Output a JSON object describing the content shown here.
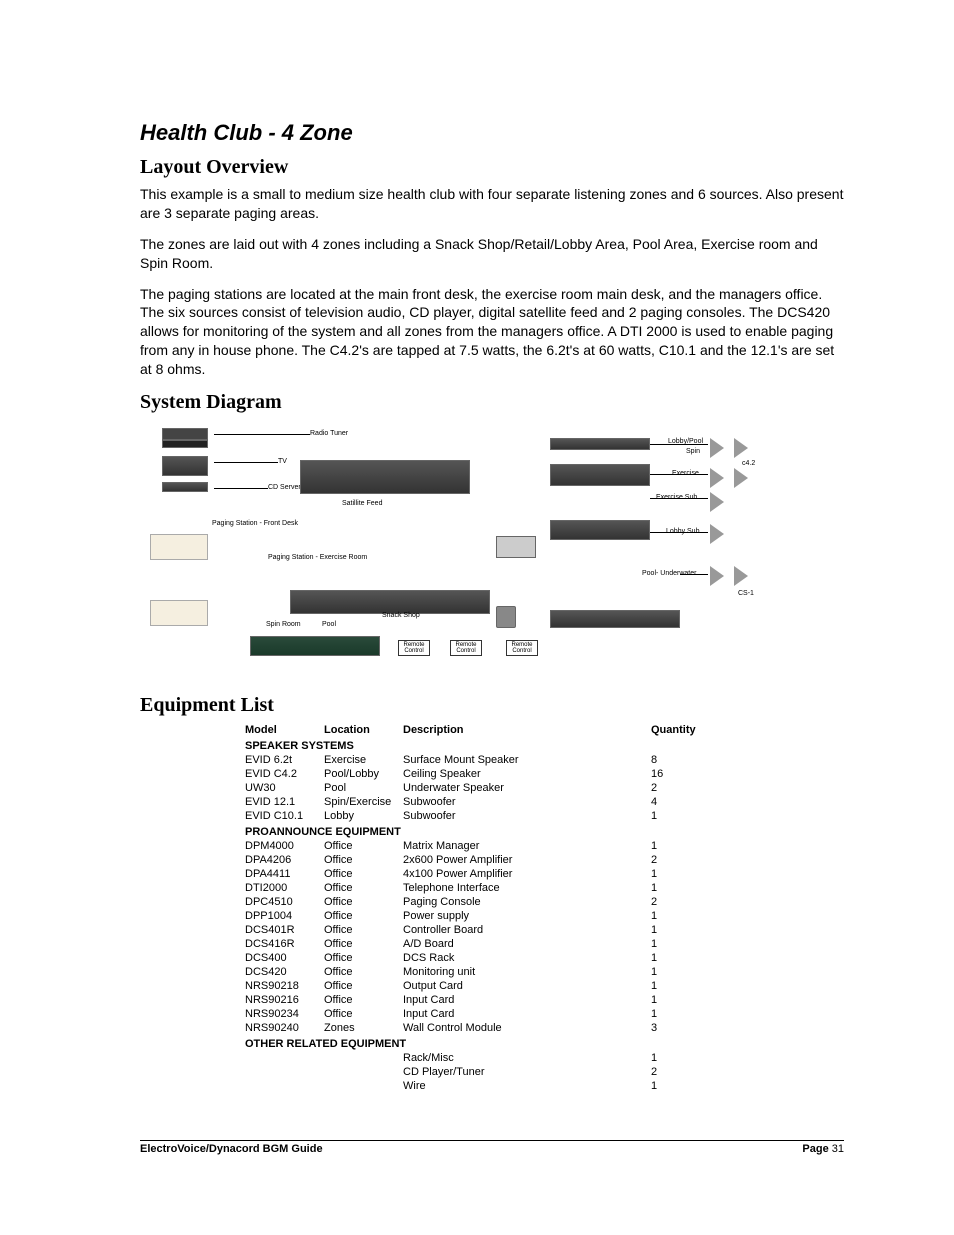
{
  "title": "Health Club - 4 Zone",
  "sections": {
    "layout_heading": "Layout Overview",
    "diagram_heading": "System Diagram",
    "equip_heading": "Equipment List"
  },
  "paragraphs": {
    "p1": "This example is a small to medium size health club with four separate listening zones and 6 sources.  Also present are 3 separate paging areas.",
    "p2": "The zones are laid out with 4 zones including a Snack Shop/Retail/Lobby Area, Pool Area, Exercise room and Spin Room.",
    "p3": "The paging stations are located at the main front desk, the exercise room main desk, and the managers office.  The six sources consist of  television audio, CD player, digital satellite feed and 2 paging consoles.  The DCS420 allows for monitoring of the system and all zones from the managers office.  A DTI 2000 is used to enable paging from any in house phone.  The C4.2's are tapped at 7.5 watts,  the 6.2t's at 60 watts,  C10.1 and the 12.1's are set at 8 ohms."
  },
  "diagram_labels": {
    "radio_tuner": "Radio Tuner",
    "tv": "TV",
    "cd_server": "CD Server",
    "satellite": "Satillite Feed",
    "paging_front": "Paging Station - Front Desk",
    "paging_ex": "Paging Station - Exercise Room",
    "lobby_pool": "Lobby/Pool",
    "spin": "Spin",
    "exercise": "Exercise",
    "exercise_sub": "Exercise Sub",
    "lobby_sub": "Lobby Sub",
    "pool_under": "Pool- Underwater",
    "spin_room": "Spin Room",
    "pool": "Pool",
    "snack_shop": "Snack Shop",
    "remote": "Remote Control",
    "c42": "c4.2",
    "cs1": "CS-1"
  },
  "equipment": {
    "headers": {
      "model": "Model",
      "location": "Location",
      "description": "Description",
      "quantity": "Quantity"
    },
    "groups": [
      {
        "title": "SPEAKER SYSTEMS",
        "rows": [
          {
            "model": "EVID 6.2t",
            "location": "Exercise",
            "description": "Surface Mount Speaker",
            "qty": "8"
          },
          {
            "model": "EVID C4.2",
            "location": "Pool/Lobby",
            "description": "Ceiling Speaker",
            "qty": "16"
          },
          {
            "model": "UW30",
            "location": "Pool",
            "description": "Underwater Speaker",
            "qty": "2"
          },
          {
            "model": "EVID 12.1",
            "location": "Spin/Exercise",
            "description": "Subwoofer",
            "qty": "4"
          },
          {
            "model": "EVID C10.1",
            "location": "Lobby",
            "description": "Subwoofer",
            "qty": "1"
          }
        ]
      },
      {
        "title": "PROANNOUNCE EQUIPMENT",
        "rows": [
          {
            "model": "DPM4000",
            "location": "Office",
            "description": "Matrix Manager",
            "qty": "1"
          },
          {
            "model": "DPA4206",
            "location": "Office",
            "description": "2x600 Power Amplifier",
            "qty": "2"
          },
          {
            "model": "DPA4411",
            "location": "Office",
            "description": "4x100 Power Amplifier",
            "qty": "1"
          },
          {
            "model": "DTI2000",
            "location": "Office",
            "description": "Telephone Interface",
            "qty": "1"
          },
          {
            "model": "DPC4510",
            "location": "Office",
            "description": "Paging Console",
            "qty": "2"
          },
          {
            "model": "DPP1004",
            "location": "Office",
            "description": "Power supply",
            "qty": "1"
          },
          {
            "model": "DCS401R",
            "location": "Office",
            "description": "Controller Board",
            "qty": "1"
          },
          {
            "model": "DCS416R",
            "location": "Office",
            "description": "A/D Board",
            "qty": "1"
          },
          {
            "model": "DCS400",
            "location": "Office",
            "description": "DCS Rack",
            "qty": "1"
          },
          {
            "model": "DCS420",
            "location": "Office",
            "description": "Monitoring unit",
            "qty": "1"
          },
          {
            "model": "NRS90218",
            "location": "Office",
            "description": "Output Card",
            "qty": "1"
          },
          {
            "model": "NRS90216",
            "location": "Office",
            "description": "Input Card",
            "qty": "1"
          },
          {
            "model": "NRS90234",
            "location": "Office",
            "description": "Input Card",
            "qty": "1"
          },
          {
            "model": "NRS90240",
            "location": "Zones",
            "description": "Wall Control Module",
            "qty": "3"
          }
        ]
      },
      {
        "title": "OTHER RELATED EQUIPMENT",
        "rows": [
          {
            "model": "",
            "location": "",
            "description": "Rack/Misc",
            "qty": "1"
          },
          {
            "model": "",
            "location": "",
            "description": "CD Player/Tuner",
            "qty": "2"
          },
          {
            "model": "",
            "location": "",
            "description": "Wire",
            "qty": "1"
          }
        ]
      }
    ]
  },
  "footer": {
    "left": "ElectroVoice/Dynacord BGM Guide",
    "page_label": "Page",
    "page_num": "31"
  }
}
